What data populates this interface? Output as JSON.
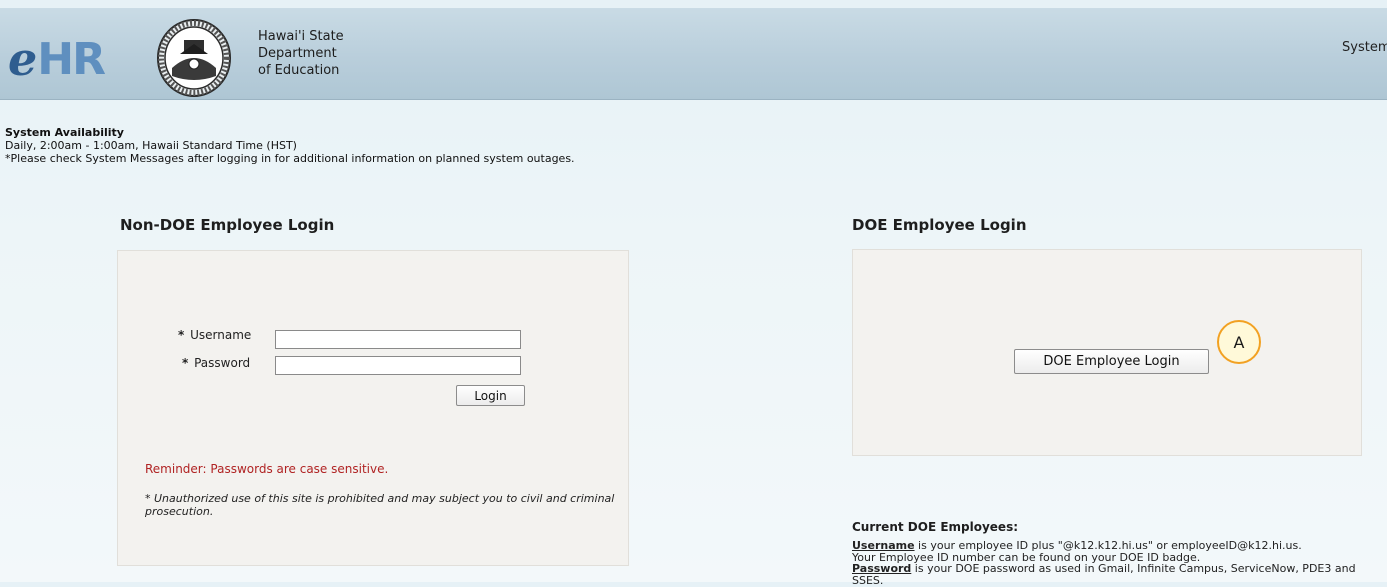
{
  "header": {
    "logo_e": "e",
    "logo_hr": "HR",
    "org_line1": "Hawai'i State",
    "org_line2": "Department",
    "org_line3": "of Education",
    "system_link": "System"
  },
  "availability": {
    "title": "System Availability",
    "line1": "Daily, 2:00am - 1:00am, Hawaii Standard Time (HST)",
    "line2": "*Please check System Messages after logging in for additional information on planned system outages."
  },
  "non_doe": {
    "title": "Non-DOE Employee Login",
    "required_mark": "*",
    "username_label": "Username",
    "password_label": "Password",
    "username_value": "",
    "password_value": "",
    "login_button": "Login",
    "reminder": "Reminder: Passwords are case sensitive.",
    "disclaimer": "* Unauthorized use of this site is prohibited and may subject you to civil and criminal prosecution."
  },
  "doe": {
    "title": "DOE Employee Login",
    "login_button": "DOE Employee Login",
    "marker": "A",
    "current_title": "Current DOE Employees:",
    "username_term": "Username",
    "username_text": " is your employee ID plus \"@k12.k12.hi.us\" or employeeID@k12.hi.us.",
    "id_text": "Your Employee ID number can be found on your DOE ID badge.",
    "password_term": "Password",
    "password_text": " is your DOE password as used in Gmail, Infinite Campus, ServiceNow, PDE3 and SSES."
  },
  "colors": {
    "header_bg": "#b9cedb",
    "reminder": "#b02323",
    "marker_border": "#f2a122",
    "marker_fill": "#fff9d9"
  }
}
